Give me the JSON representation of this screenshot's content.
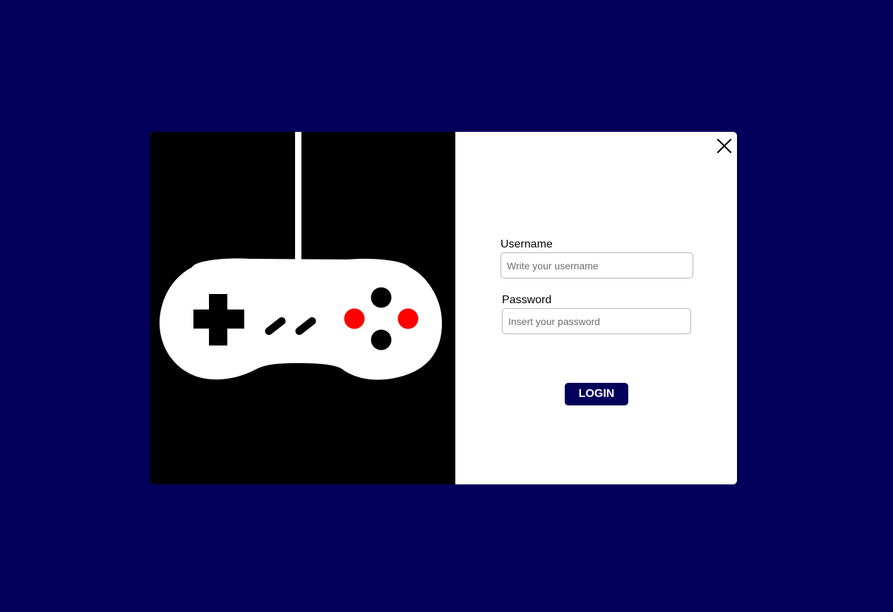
{
  "colors": {
    "background": "#02005a",
    "button": "#02005a",
    "accent_red": "#ff0000"
  },
  "illustration": {
    "icon": "game-controller-icon"
  },
  "close": {
    "icon": "close-icon",
    "label": "X"
  },
  "form": {
    "username": {
      "label": "Username",
      "placeholder": "Write your username",
      "value": ""
    },
    "password": {
      "label": "Password",
      "placeholder": "Insert your password",
      "value": ""
    },
    "login_label": "LOGIN"
  }
}
